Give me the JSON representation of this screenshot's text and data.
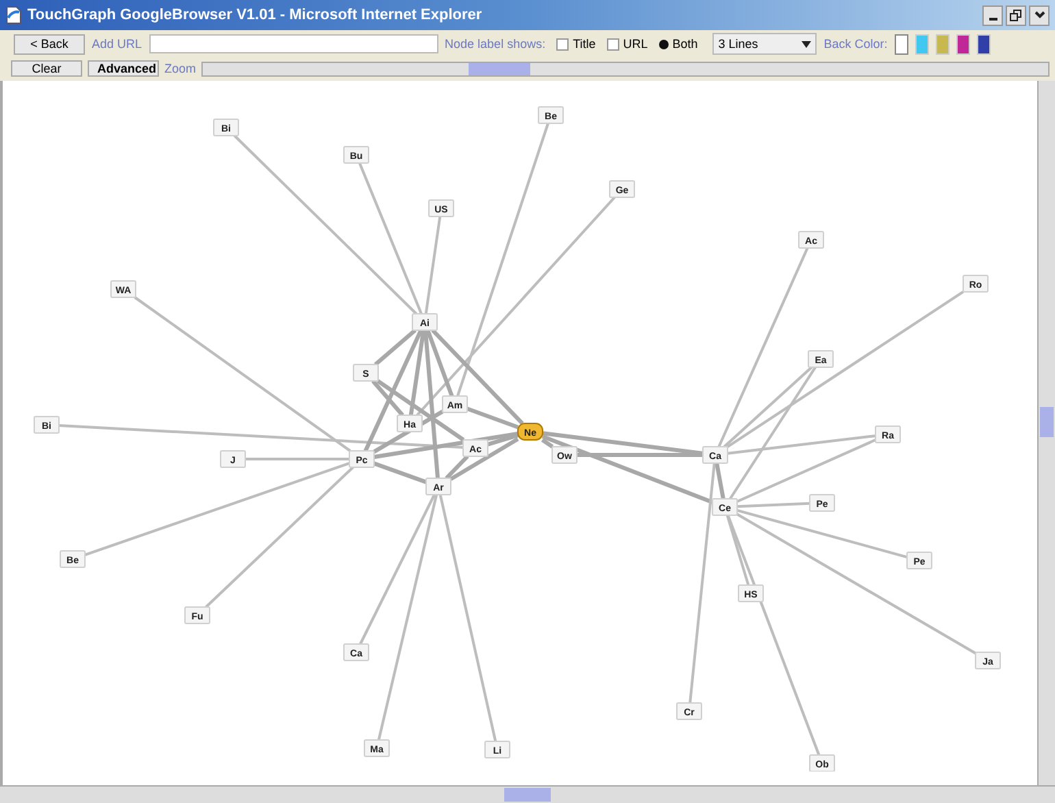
{
  "window": {
    "title": "TouchGraph GoogleBrowser V1.01 - Microsoft Internet Explorer"
  },
  "toolbar": {
    "back_button": "< Back",
    "add_url_label": "Add URL",
    "node_label_caption": "Node label shows:",
    "label_options": [
      {
        "kind": "checkbox",
        "label": "Title",
        "selected": false
      },
      {
        "kind": "checkbox",
        "label": "URL",
        "selected": false
      },
      {
        "kind": "radio",
        "label": "Both",
        "selected": true
      }
    ],
    "lines_dropdown": "3 Lines",
    "back_color_label": "Back Color:",
    "colors": [
      {
        "color": "#ffffff",
        "selected": true
      },
      {
        "color": "#40c8f0",
        "selected": false
      },
      {
        "color": "#c8b850",
        "selected": false
      },
      {
        "color": "#c02898",
        "selected": false
      },
      {
        "color": "#3040a8",
        "selected": false
      }
    ],
    "clear_button": "Clear",
    "advanced_button": "Advanced",
    "zoom_label": "Zoom",
    "zoom_slider": {
      "level": 0.35
    }
  },
  "graph": {
    "nodes": [
      {
        "label": "Ai",
        "selected": false
      },
      {
        "label": "Am",
        "selected": false
      },
      {
        "label": "Pc",
        "selected": false
      },
      {
        "label": "Ar",
        "selected": false
      },
      {
        "label": "Ne",
        "selected": true
      },
      {
        "label": "Ow",
        "selected": false
      },
      {
        "label": "Ac",
        "selected": false
      },
      {
        "label": "Ha",
        "selected": false
      },
      {
        "label": "S",
        "selected": false
      },
      {
        "label": "Ca",
        "selected": false
      },
      {
        "label": "Ce",
        "selected": false
      },
      {
        "label": "Bi",
        "selected": false
      },
      {
        "label": "Bu",
        "selected": false
      },
      {
        "label": "US",
        "selected": false
      },
      {
        "label": "Be",
        "selected": false
      },
      {
        "label": "Ge",
        "selected": false
      },
      {
        "label": "WA",
        "selected": false
      },
      {
        "label": "Bi",
        "selected": false
      },
      {
        "label": "J",
        "selected": false
      },
      {
        "label": "Be",
        "selected": false
      },
      {
        "label": "Fu",
        "selected": false
      },
      {
        "label": "Ca",
        "selected": false
      },
      {
        "label": "Ma",
        "selected": false
      },
      {
        "label": "Li",
        "selected": false
      },
      {
        "label": "Ac",
        "selected": false
      },
      {
        "label": "Ro",
        "selected": false
      },
      {
        "label": "Ea",
        "selected": false
      },
      {
        "label": "Ra",
        "selected": false
      },
      {
        "label": "Pe",
        "selected": false
      },
      {
        "label": "Pe",
        "selected": false
      },
      {
        "label": "Ja",
        "selected": false
      },
      {
        "label": "HS",
        "selected": false
      },
      {
        "label": "Cr",
        "selected": false
      },
      {
        "label": "Ob",
        "selected": false
      }
    ]
  }
}
